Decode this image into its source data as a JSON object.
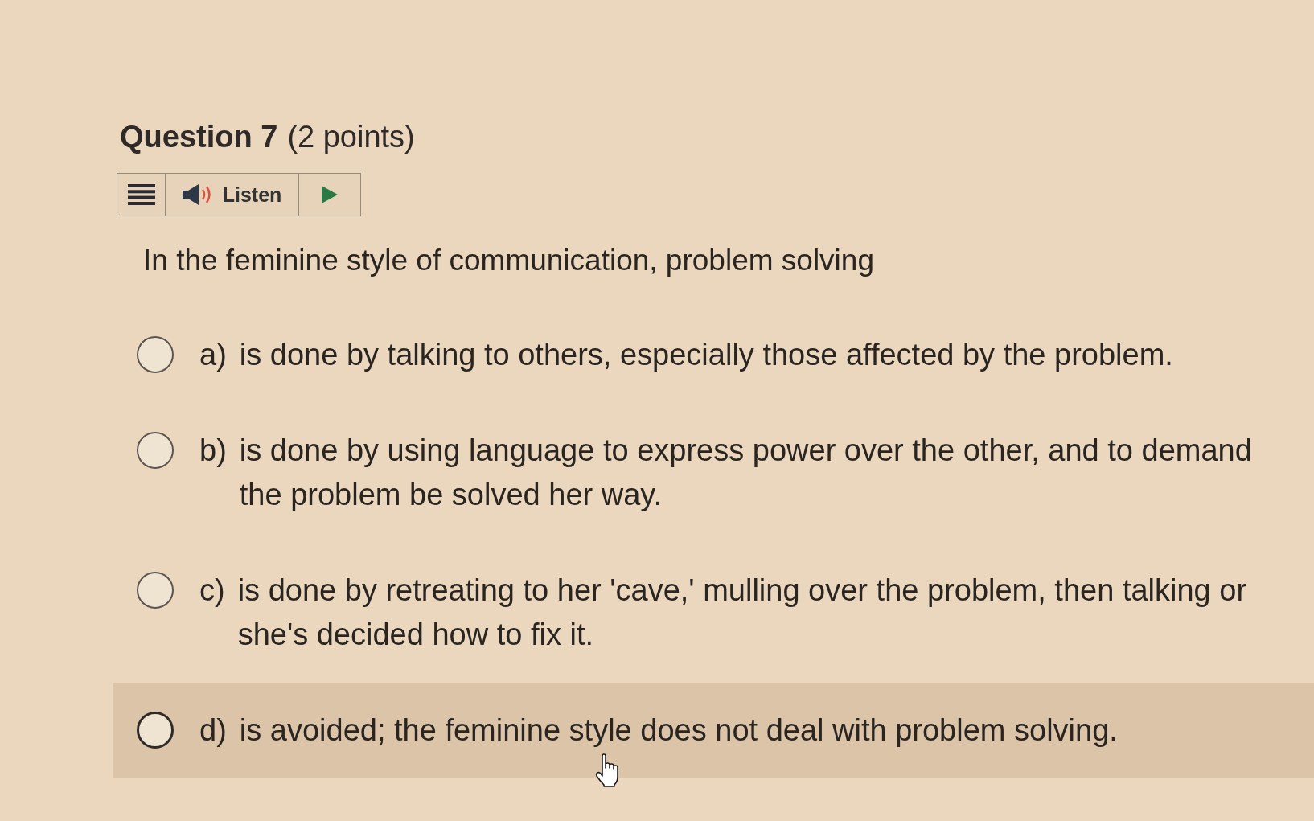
{
  "question": {
    "title": "Question 7",
    "points": "(2 points)",
    "prompt": "In the feminine style of communication, problem solving"
  },
  "toolbar": {
    "listen_label": "Listen"
  },
  "options": [
    {
      "letter": "a)",
      "text": "is done by talking to others, especially those affected by the problem.",
      "selected": false,
      "hovered": false
    },
    {
      "letter": "b)",
      "text": "is done by using language to express power over the other, and to demand the problem be solved her way.",
      "selected": false,
      "hovered": false
    },
    {
      "letter": "c)",
      "text": "is done by retreating to her 'cave,' mulling over the problem, then talking or she's decided how to fix it.",
      "selected": false,
      "hovered": false
    },
    {
      "letter": "d)",
      "text": "is avoided; the feminine style does not deal with problem solving.",
      "selected": false,
      "hovered": true
    }
  ]
}
